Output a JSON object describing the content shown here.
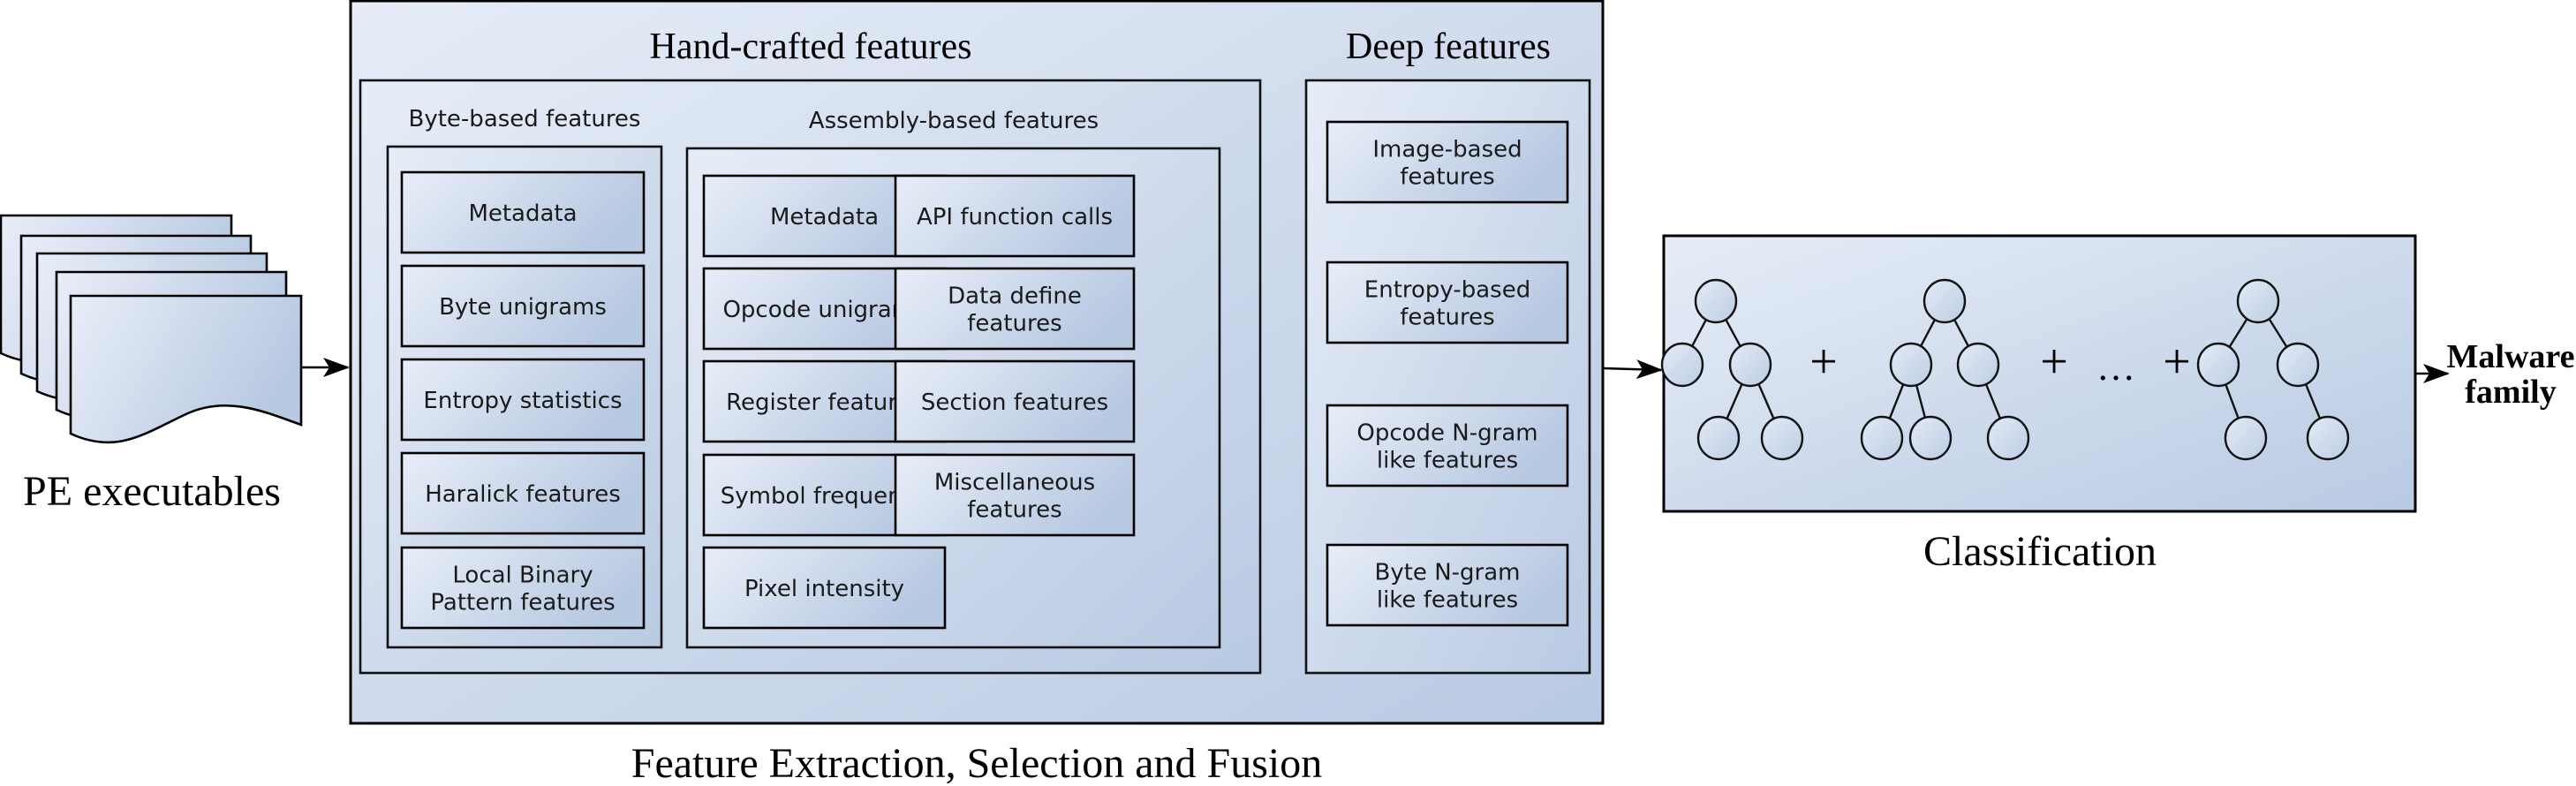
{
  "colors": {
    "gradient_light": "#e9eff8",
    "gradient_dark": "#b8c9e2",
    "stroke": "#000000",
    "text": "#000000"
  },
  "input": {
    "label": "PE executables",
    "document_count": 5
  },
  "feature_stage": {
    "caption": "Feature Extraction, Selection and Fusion",
    "hand_crafted": {
      "title": "Hand-crafted features",
      "byte_group": {
        "title": "Byte-based features",
        "items": [
          [
            "Metadata"
          ],
          [
            "Byte unigrams"
          ],
          [
            "Entropy statistics"
          ],
          [
            "Haralick features"
          ],
          [
            "Local Binary",
            "Pattern features"
          ]
        ]
      },
      "assembly_group": {
        "title": "Assembly-based features",
        "items": [
          [
            "Metadata"
          ],
          [
            "API function calls"
          ],
          [
            "Opcode unigrams"
          ],
          [
            "Data define",
            "features"
          ],
          [
            "Register features"
          ],
          [
            "Section features"
          ],
          [
            "Symbol frequency"
          ],
          [
            "Miscellaneous",
            "features"
          ],
          [
            "Pixel intensity"
          ]
        ]
      }
    },
    "deep": {
      "title": "Deep features",
      "items": [
        [
          "Image-based",
          "features"
        ],
        [
          "Entropy-based",
          "features"
        ],
        [
          "Opcode N-gram",
          "like features"
        ],
        [
          "Byte N-gram",
          "like features"
        ]
      ]
    }
  },
  "classification": {
    "caption": "Classification",
    "operators": [
      "+",
      "+",
      "...",
      "+"
    ],
    "tree_count": 3
  },
  "output": {
    "label_lines": [
      "Malware",
      "family"
    ]
  }
}
